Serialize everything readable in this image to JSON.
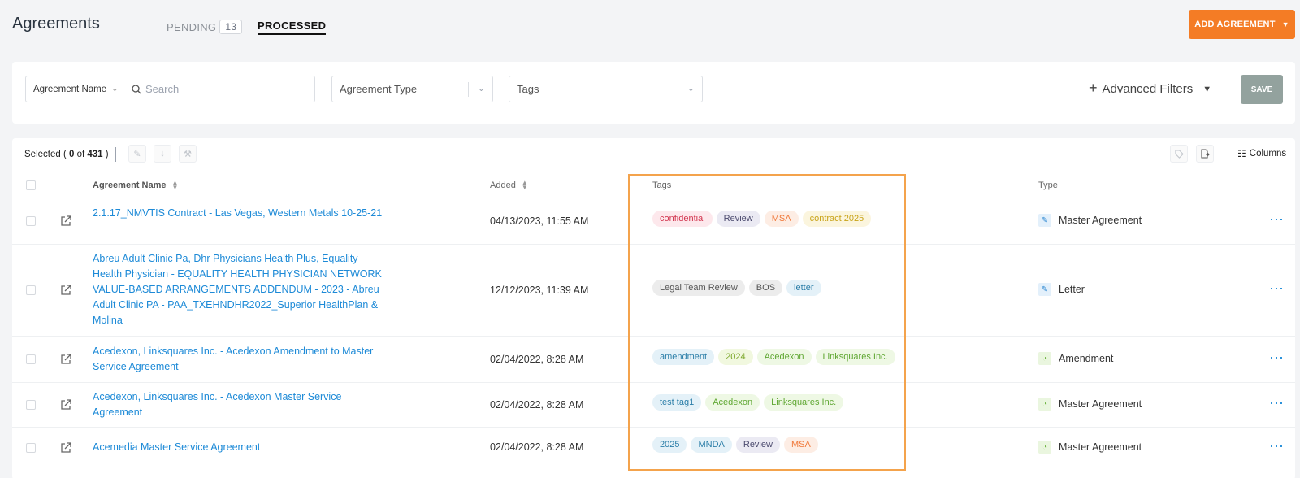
{
  "header": {
    "title": "Agreements",
    "tabs": [
      {
        "label": "PENDING",
        "count": "13"
      },
      {
        "label": "PROCESSED"
      }
    ],
    "add_button": "ADD AGREEMENT"
  },
  "filters": {
    "name_select": "Agreement Name",
    "search_placeholder": "Search",
    "type_placeholder": "Agreement Type",
    "tags_placeholder": "Tags",
    "advanced": "Advanced Filters",
    "save": "SAVE"
  },
  "toolbar": {
    "selected_prefix": "Selected (",
    "selected_count": "0",
    "selected_of": "of",
    "selected_total": "431",
    "selected_suffix": ")",
    "columns": "Columns"
  },
  "table": {
    "headers": {
      "name": "Agreement Name",
      "added": "Added",
      "tags": "Tags",
      "type": "Type"
    },
    "rows": [
      {
        "name": "2.1.17_NMVTIS Contract - Las Vegas, Western Metals 10-25-21",
        "added": "04/13/2023, 11:55 AM",
        "tags": [
          "confidential",
          "Review",
          "MSA",
          "contract 2025"
        ],
        "type": "Master Agreement"
      },
      {
        "name": "Abreu Adult Clinic Pa, Dhr Physicians Health Plus, Equality Health Physician - EQUALITY HEALTH PHYSICIAN NETWORK VALUE-BASED ARRANGEMENTS ADDENDUM - 2023 - Abreu Adult Clinic PA - PAA_TXEHNDHR2022_Superior HealthPlan & Molina",
        "added": "12/12/2023, 11:39 AM",
        "tags": [
          "Legal Team Review",
          "BOS",
          "letter"
        ],
        "type": "Letter"
      },
      {
        "name": "Acedexon, Linksquares Inc. - Acedexon Amendment to Master Service Agreement",
        "added": "02/04/2022, 8:28 AM",
        "tags": [
          "amendment",
          "2024",
          "Acedexon",
          "Linksquares Inc."
        ],
        "type": "Amendment"
      },
      {
        "name": "Acedexon, Linksquares Inc. - Acedexon Master Service Agreement",
        "added": "02/04/2022, 8:28 AM",
        "tags": [
          "test tag1",
          "Acedexon",
          "Linksquares Inc."
        ],
        "type": "Master Agreement"
      },
      {
        "name": "Acemedia Master Service Agreement",
        "added": "02/04/2022, 8:28 AM",
        "tags": [
          "2025",
          "MNDA",
          "Review",
          "MSA"
        ],
        "type": "Master Agreement"
      }
    ]
  },
  "colors": {
    "accent_orange": "#f47c25",
    "link_blue": "#1d8ad7",
    "highlight_border": "#f4a34c",
    "save_gray": "#93a29e"
  },
  "icons": {
    "edit": "pencil-icon",
    "download": "download-icon",
    "tools": "hammer-icon",
    "tag": "tag-icon",
    "export": "export-icon",
    "columns": "columns-icon",
    "open": "external-link-icon",
    "type_pencil": "pencil-icon",
    "type_bulb": "lightbulb-icon"
  }
}
